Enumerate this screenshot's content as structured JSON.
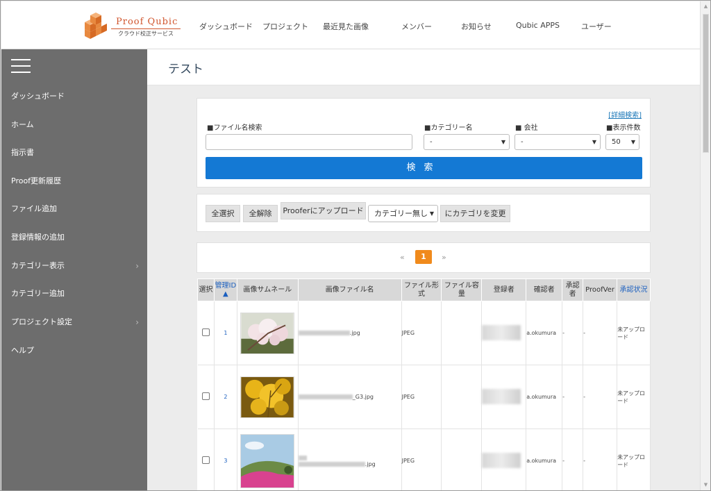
{
  "brand": {
    "name": "Proof Qubic",
    "subtitle": "クラウド校正サービス"
  },
  "topnav": [
    "ダッシュボード",
    "プロジェクト",
    "最近見た画像",
    "メンバー",
    "お知らせ",
    "Qubic APPS",
    "ユーザー"
  ],
  "sidebar": {
    "items": [
      {
        "label": "ダッシュボード",
        "has_submenu": false
      },
      {
        "label": "ホーム",
        "has_submenu": false
      },
      {
        "label": "指示書",
        "has_submenu": false
      },
      {
        "label": "Proof更新履歴",
        "has_submenu": false
      },
      {
        "label": "ファイル追加",
        "has_submenu": false
      },
      {
        "label": "登録情報の追加",
        "has_submenu": false
      },
      {
        "label": "カテゴリー表示",
        "has_submenu": true
      },
      {
        "label": "カテゴリー追加",
        "has_submenu": false
      },
      {
        "label": "プロジェクト設定",
        "has_submenu": true
      },
      {
        "label": "ヘルプ",
        "has_submenu": false
      }
    ]
  },
  "page": {
    "title": "テスト"
  },
  "search": {
    "advanced_link": "[詳細検索]",
    "filename_label": "■ファイル名検索",
    "filename_value": "",
    "category_label": "■カテゴリー名",
    "category_value": "-",
    "company_label": "■ 会社",
    "company_value": "-",
    "count_label": "■表示件数",
    "count_value": "50",
    "search_button": "検索"
  },
  "actions": {
    "select_all": "全選択",
    "deselect_all": "全解除",
    "upload": "Prooferにアップロード",
    "category_select": "カテゴリー無し",
    "change_category": "にカテゴリを変更"
  },
  "pagination": {
    "prev": "«",
    "current": "1",
    "next": "»"
  },
  "table": {
    "headers": [
      "選択",
      "管理ID ▲",
      "画像サムネール",
      "画像ファイル名",
      "ファイル形式",
      "ファイル容量",
      "登録者",
      "確認者",
      "承認者",
      "ProofVer",
      "承認状況"
    ],
    "rows": [
      {
        "id": "1",
        "filename_suffix": ".jpg",
        "format": "JPEG",
        "size": "",
        "confirmer": "a.okumura",
        "approver": "-",
        "proofver": "-",
        "status": "未アップロード"
      },
      {
        "id": "2",
        "filename_suffix": "_G3.jpg",
        "format": "JPEG",
        "size": "",
        "confirmer": "a.okumura",
        "approver": "-",
        "proofver": "-",
        "status": "未アップロード"
      },
      {
        "id": "3",
        "filename_suffix": ".jpg",
        "format": "JPEG",
        "size": "",
        "confirmer": "a.okumura",
        "approver": "-",
        "proofver": "-",
        "status": "未アップロード"
      }
    ]
  },
  "colors": {
    "accent": "#1479d4",
    "sidebar": "#6d6d6d",
    "page_current": "#f08a1c",
    "brand": "#d0542c"
  }
}
